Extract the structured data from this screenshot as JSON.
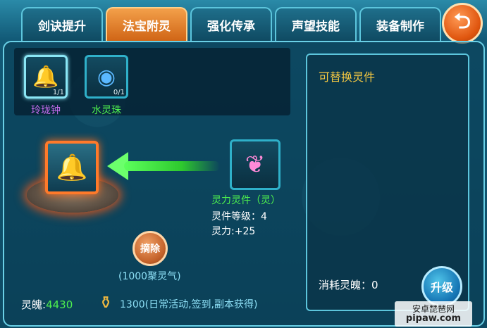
{
  "tabs": [
    {
      "label": "剑诀提升",
      "active": false
    },
    {
      "label": "法宝附灵",
      "active": true
    },
    {
      "label": "强化传承",
      "active": false
    },
    {
      "label": "声望技能",
      "active": false
    },
    {
      "label": "装备制作",
      "active": false
    }
  ],
  "slots": [
    {
      "name": "玲珑钟",
      "count": "1/1",
      "color": "#c86cf0",
      "icon": "bell-icon"
    },
    {
      "name": "水灵珠",
      "count": "0/1",
      "color": "#4ef04e",
      "icon": "water-orb-icon"
    }
  ],
  "center": {
    "spirit_name": "灵力灵件（灵）",
    "spirit_level": "灵件等级：4",
    "spirit_power": "灵力:+25",
    "remove_label": "摘除",
    "remove_cost": "(1000聚灵气)"
  },
  "footer": {
    "soul_label": "灵魄:",
    "soul_value": "4430",
    "gain_text": "1300(日常活动,签到,副本获得)"
  },
  "right_panel": {
    "title": "可替换灵件",
    "consume": "消耗灵魄：0",
    "upgrade_label": "升级"
  },
  "watermark": {
    "line1": "安卓琵琶网",
    "line2": "pipaw.com"
  },
  "colors": {
    "accent_orange": "#d06516",
    "accent_green": "#4ef04e",
    "accent_yellow": "#f4c842"
  }
}
